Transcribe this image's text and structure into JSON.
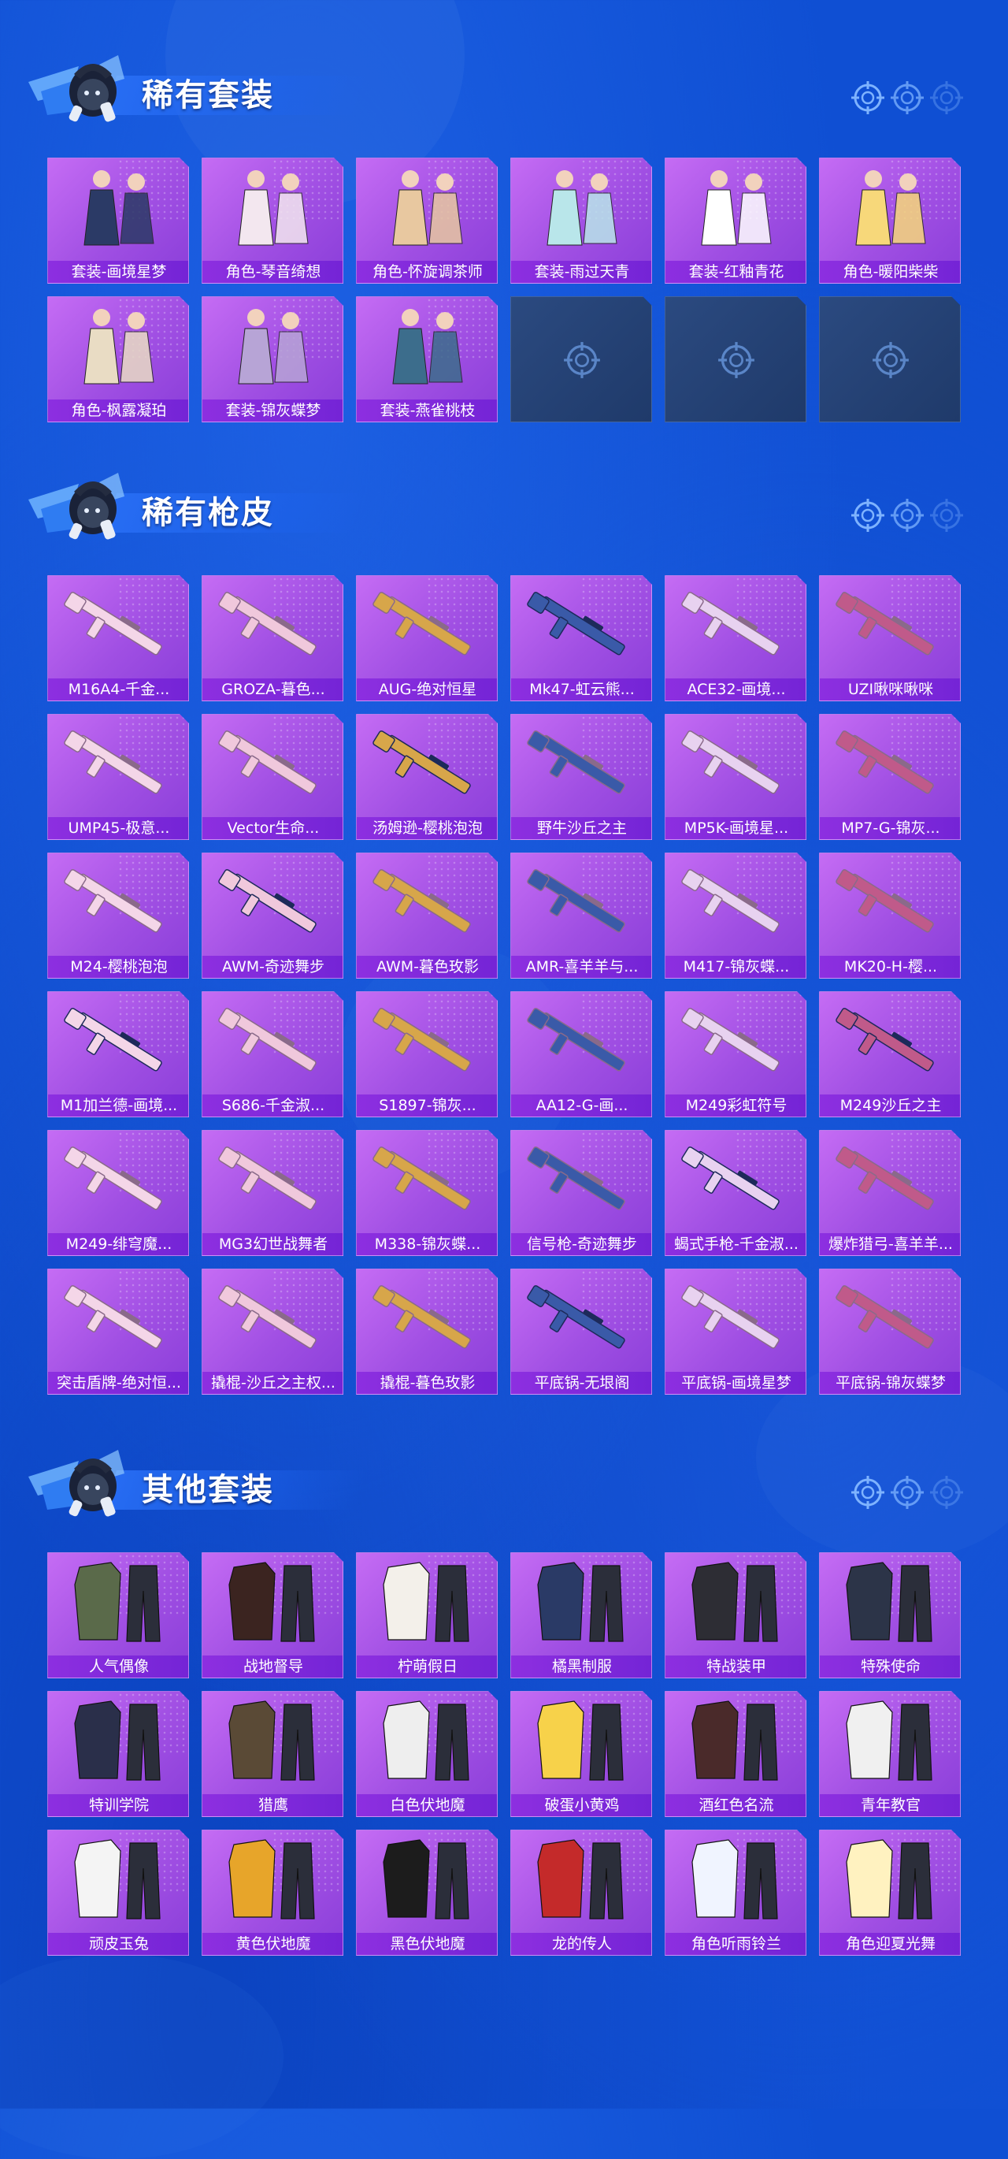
{
  "sections": [
    {
      "title": "稀有套装",
      "items": [
        "套装-画境星梦",
        "角色-琴音绮想",
        "角色-怀旋调茶师",
        "套装-雨过天青",
        "套装-红釉青花",
        "角色-暖阳柴柴",
        "角色-枫露凝珀",
        "套装-锦灰蝶梦",
        "套装-燕雀桃枝"
      ]
    },
    {
      "title": "稀有枪皮",
      "items": [
        "M16A4-千金...",
        "GROZA-暮色...",
        "AUG-绝对恒星",
        "Mk47-虹云熊...",
        "ACE32-画境...",
        "UZI啾咪啾咪",
        "UMP45-极意...",
        "Vector生命...",
        "汤姆逊-樱桃泡泡",
        "野牛沙丘之主",
        "MP5K-画境星...",
        "MP7-G-锦灰...",
        "M24-樱桃泡泡",
        "AWM-奇迹舞步",
        "AWM-暮色玫影",
        "AMR-喜羊羊与...",
        "M417-锦灰蝶...",
        "MK20-H-樱...",
        "M1加兰德-画境...",
        "S686-千金淑...",
        "S1897-锦灰...",
        "AA12-G-画...",
        "M249彩虹符号",
        "M249沙丘之主",
        "M249-绯穹魔...",
        "MG3幻世战舞者",
        "M338-锦灰蝶...",
        "信号枪-奇迹舞步",
        "蝎式手枪-千金淑...",
        "爆炸猎弓-喜羊羊...",
        "突击盾牌-绝对恒...",
        "撬棍-沙丘之主权...",
        "撬棍-暮色玫影",
        "平底锅-无垠阁",
        "平底锅-画境星梦",
        "平底锅-锦灰蝶梦"
      ]
    },
    {
      "title": "其他套装",
      "items": [
        "人气偶像",
        "战地督导",
        "柠萌假日",
        "橘黑制服",
        "特战装甲",
        "特殊使命",
        "特训学院",
        "猎鹰",
        "白色伏地魔",
        "破蛋小黄鸡",
        "酒红色名流",
        "青年教官",
        "顽皮玉兔",
        "黄色伏地魔",
        "黑色伏地魔",
        "龙的传人",
        "角色听雨铃兰",
        "角色迎夏光舞"
      ]
    }
  ],
  "icons": {
    "section_emblem": "hooded-mascot-icon",
    "header_decoration": "crosshair-target-icon",
    "empty_slot": "crosshair-target-icon"
  },
  "colors": {
    "background": "#0f4fd3",
    "card_top": "#c56cf4",
    "card_bottom": "#8a3ed9",
    "label_bar": "#7424d6",
    "empty_slot": "#1f3a6a"
  }
}
